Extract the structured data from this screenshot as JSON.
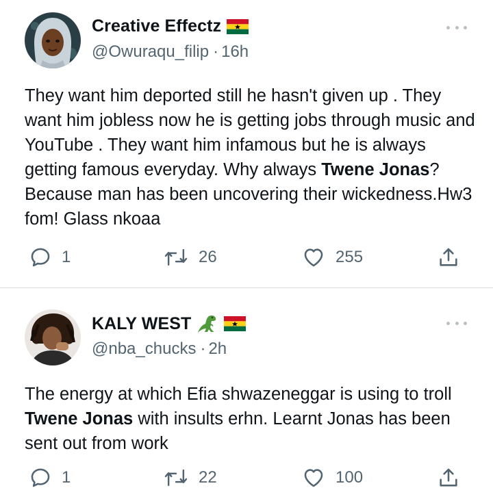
{
  "tweets": [
    {
      "name": "Creative Effectz",
      "handle": "@Owuraqu_filip",
      "sep": "·",
      "time": "16h",
      "text_parts": [
        "They want him deported still he hasn't given up . They want him jobless now he is getting jobs through music and YouTube . They want him infamous but he is always getting famous everyday. Why always ",
        "Twene Jonas",
        "?Because man has been uncovering their wickedness.Hw3 fom! Glass nkoaa"
      ],
      "replies": "1",
      "retweets": "26",
      "likes": "255"
    },
    {
      "name": "KALY WEST",
      "handle": "@nba_chucks",
      "sep": "·",
      "time": "2h",
      "text_parts": [
        "The energy at which Efia shwazeneggar is using to troll ",
        "Twene Jonas",
        " with insults erhn. Learnt Jonas has been sent out from work"
      ],
      "replies": "1",
      "retweets": "22",
      "likes": "100"
    }
  ],
  "icons": {
    "reply": "reply-icon",
    "retweet": "retweet-icon",
    "like": "heart-icon",
    "share": "share-icon",
    "more": "more-icon",
    "flag": "ghana-flag-icon",
    "emoji": "t-rex-emoji-icon"
  },
  "colors": {
    "text": "#0f1419",
    "secondary": "#536471",
    "divider": "#dcdcdc",
    "flag_red": "#ce1126",
    "flag_gold": "#fcd116",
    "flag_green": "#006b3f"
  }
}
